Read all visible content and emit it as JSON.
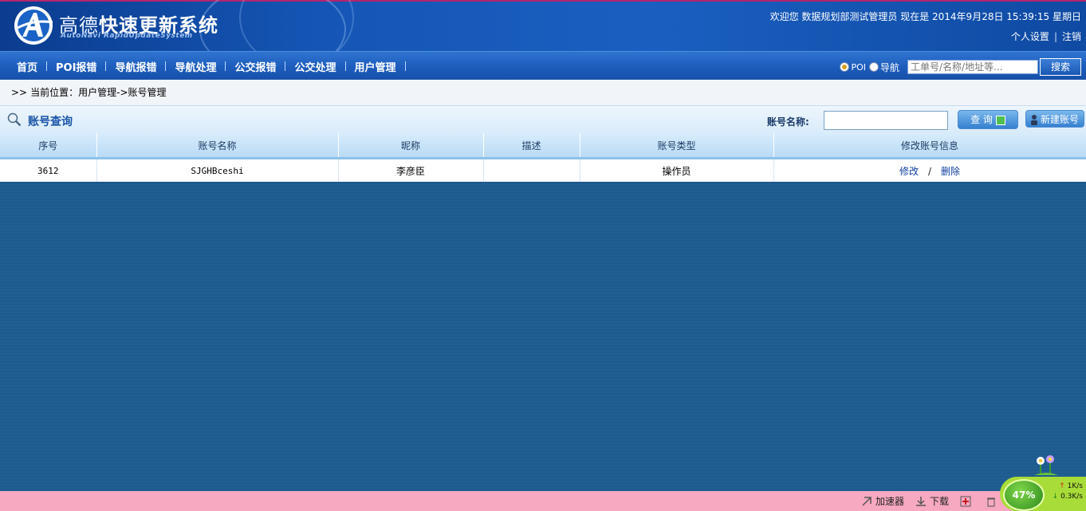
{
  "header": {
    "logo_cn_brand": "高德",
    "logo_cn_title": "快速更新系统",
    "logo_en": "AutoNavi RapidUpdateSystem",
    "welcome": "欢迎您  数据规划部测试管理员  现在是 2014年9月28日 15:39:15 星期日",
    "user_menu": [
      "个人设置",
      "注销"
    ]
  },
  "nav": {
    "items": [
      "首页",
      "POI报错",
      "导航报错",
      "导航处理",
      "公交报错",
      "公交处理",
      "用户管理"
    ],
    "radio_poi": "POI",
    "radio_nav": "导航",
    "radio_selected": "POI",
    "search_placeholder": "工单号/名称/地址等...",
    "search_button": "搜索"
  },
  "breadcrumb": {
    "arrow": ">>",
    "text": "当前位置：用户管理->账号管理"
  },
  "panel": {
    "title": "账号查询",
    "filter_label": "账号名称:",
    "filter_value": "",
    "query_button": "查 询",
    "new_button": "新建账号"
  },
  "table": {
    "columns": [
      "序号",
      "账号名称",
      "昵称",
      "描述",
      "账号类型",
      "修改账号信息"
    ],
    "rows": [
      {
        "id": "3612",
        "account": "SJGHBceshi",
        "nickname": "李彦臣",
        "desc": "",
        "type": "操作员",
        "edit": "修改",
        "sep": "/",
        "delete": "删除"
      }
    ]
  },
  "statusbar": {
    "accelerator": "加速器",
    "download": "下载",
    "percent": "47%",
    "up_rate": "1K/s",
    "down_rate": "0.3K/s"
  },
  "colors": {
    "header_blue": "#1556b5",
    "nav_blue": "#1c5cbb",
    "body_blue": "#1d5a8e",
    "statusbar_pink": "#f7a9c1",
    "link_blue": "#1140a0"
  }
}
